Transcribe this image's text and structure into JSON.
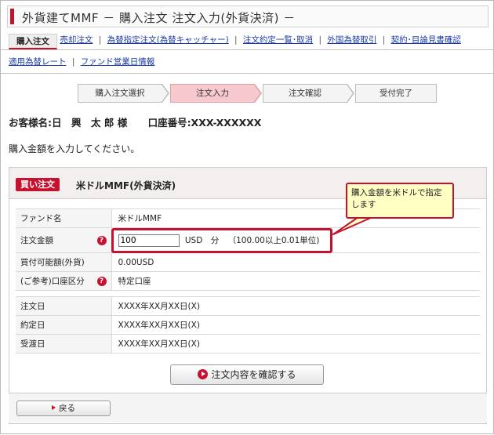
{
  "page": {
    "title": "外貨建てMMF － 購入注文 注文入力(外貨決済) －"
  },
  "nav": {
    "active_tab": "購入注文",
    "row1_links": [
      "売却注文",
      "為替指定注文(為替キャッチャー)",
      "注文約定一覧･取消",
      "外国為替取引",
      "契約･目論見書確認"
    ],
    "row2_links": [
      "適用為替レート",
      "ファンド営業日情報"
    ],
    "separator": "|"
  },
  "steps": [
    {
      "label": "購入注文選択",
      "active": false
    },
    {
      "label": "注文入力",
      "active": true
    },
    {
      "label": "注文確認",
      "active": false
    },
    {
      "label": "受付完了",
      "active": false
    }
  ],
  "customer": {
    "name_text": "お客様名:日　興　太 郎 様",
    "account_text": "口座番号:XXX-XXXXXX"
  },
  "instruction": "購入金額を入力してください。",
  "panel": {
    "badge": "買い注文",
    "title": "米ドルMMF(外貨決済)"
  },
  "form": {
    "rows_top": [
      {
        "label": "ファンド名",
        "value": "米ドルMMF",
        "help": false
      },
      {
        "label": "注文金額",
        "input_value": "100",
        "unit": "USD　分",
        "hint": "（100.00以上0.01単位)",
        "help": true
      },
      {
        "label": "買付可能額(外貨)",
        "value": "0.00USD",
        "help": false
      },
      {
        "label": "(ご参考)口座区分",
        "value": "特定口座",
        "help": true
      }
    ],
    "rows_bottom": [
      {
        "label": "注文日",
        "value": "XXXX年XX月XX日(X)"
      },
      {
        "label": "約定日",
        "value": "XXXX年XX月XX日(X)"
      },
      {
        "label": "受渡日",
        "value": "XXXX年XX月XX日(X)"
      }
    ],
    "help_glyph": "?"
  },
  "buttons": {
    "confirm": "注文内容を確認する",
    "back": "戻る"
  },
  "callout": {
    "text": "購入金額を米ドルで指定します"
  },
  "colors": {
    "accent": "#c4122f",
    "callout_bg": "#ffffc4",
    "active_step": "#f6c9cf",
    "link": "#1a3aa8"
  }
}
